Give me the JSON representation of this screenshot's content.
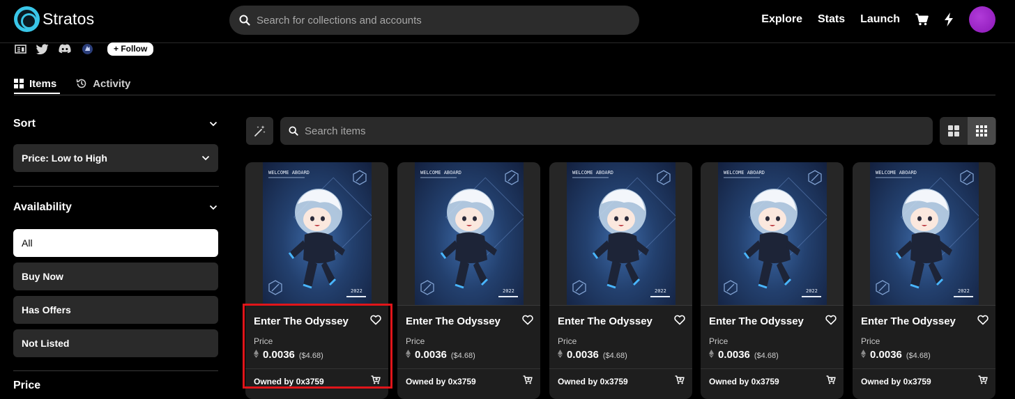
{
  "app": {
    "name": "Stratos"
  },
  "header": {
    "search_placeholder": "Search for collections and accounts",
    "nav": [
      "Explore",
      "Stats",
      "Launch"
    ]
  },
  "collection": {
    "follow_label": "+ Follow"
  },
  "tabs": [
    {
      "label": "Items",
      "active": true
    },
    {
      "label": "Activity",
      "active": false
    }
  ],
  "sidebar": {
    "sort": {
      "title": "Sort",
      "selected": "Price: Low to High"
    },
    "availability": {
      "title": "Availability",
      "options": [
        {
          "label": "All",
          "selected": true
        },
        {
          "label": "Buy Now",
          "selected": false
        },
        {
          "label": "Has Offers",
          "selected": false
        },
        {
          "label": "Not Listed",
          "selected": false
        }
      ]
    },
    "price": {
      "title": "Price"
    }
  },
  "toolbar": {
    "search_placeholder": "Search items"
  },
  "items": [
    {
      "title": "Enter The Odyssey",
      "price_label": "Price",
      "price": "0.0036",
      "usd": "($4.68)",
      "owner": "Owned by 0x3759",
      "art_header": "WELCOME ABOARD",
      "art_year": "2022"
    },
    {
      "title": "Enter The Odyssey",
      "price_label": "Price",
      "price": "0.0036",
      "usd": "($4.68)",
      "owner": "Owned by 0x3759",
      "art_header": "WELCOME ABOARD",
      "art_year": "2022"
    },
    {
      "title": "Enter The Odyssey",
      "price_label": "Price",
      "price": "0.0036",
      "usd": "($4.68)",
      "owner": "Owned by 0x3759",
      "art_header": "WELCOME ABOARD",
      "art_year": "2022"
    },
    {
      "title": "Enter The Odyssey",
      "price_label": "Price",
      "price": "0.0036",
      "usd": "($4.68)",
      "owner": "Owned by 0x3759",
      "art_header": "WELCOME ABOARD",
      "art_year": "2022"
    },
    {
      "title": "Enter The Odyssey",
      "price_label": "Price",
      "price": "0.0036",
      "usd": "($4.68)",
      "owner": "Owned by 0x3759",
      "art_header": "WELCOME ABOARD",
      "art_year": "2022"
    }
  ],
  "colors": {
    "highlight": "#e0151a",
    "brand": "#39c6e8",
    "avatar": "#9b2ac6"
  }
}
